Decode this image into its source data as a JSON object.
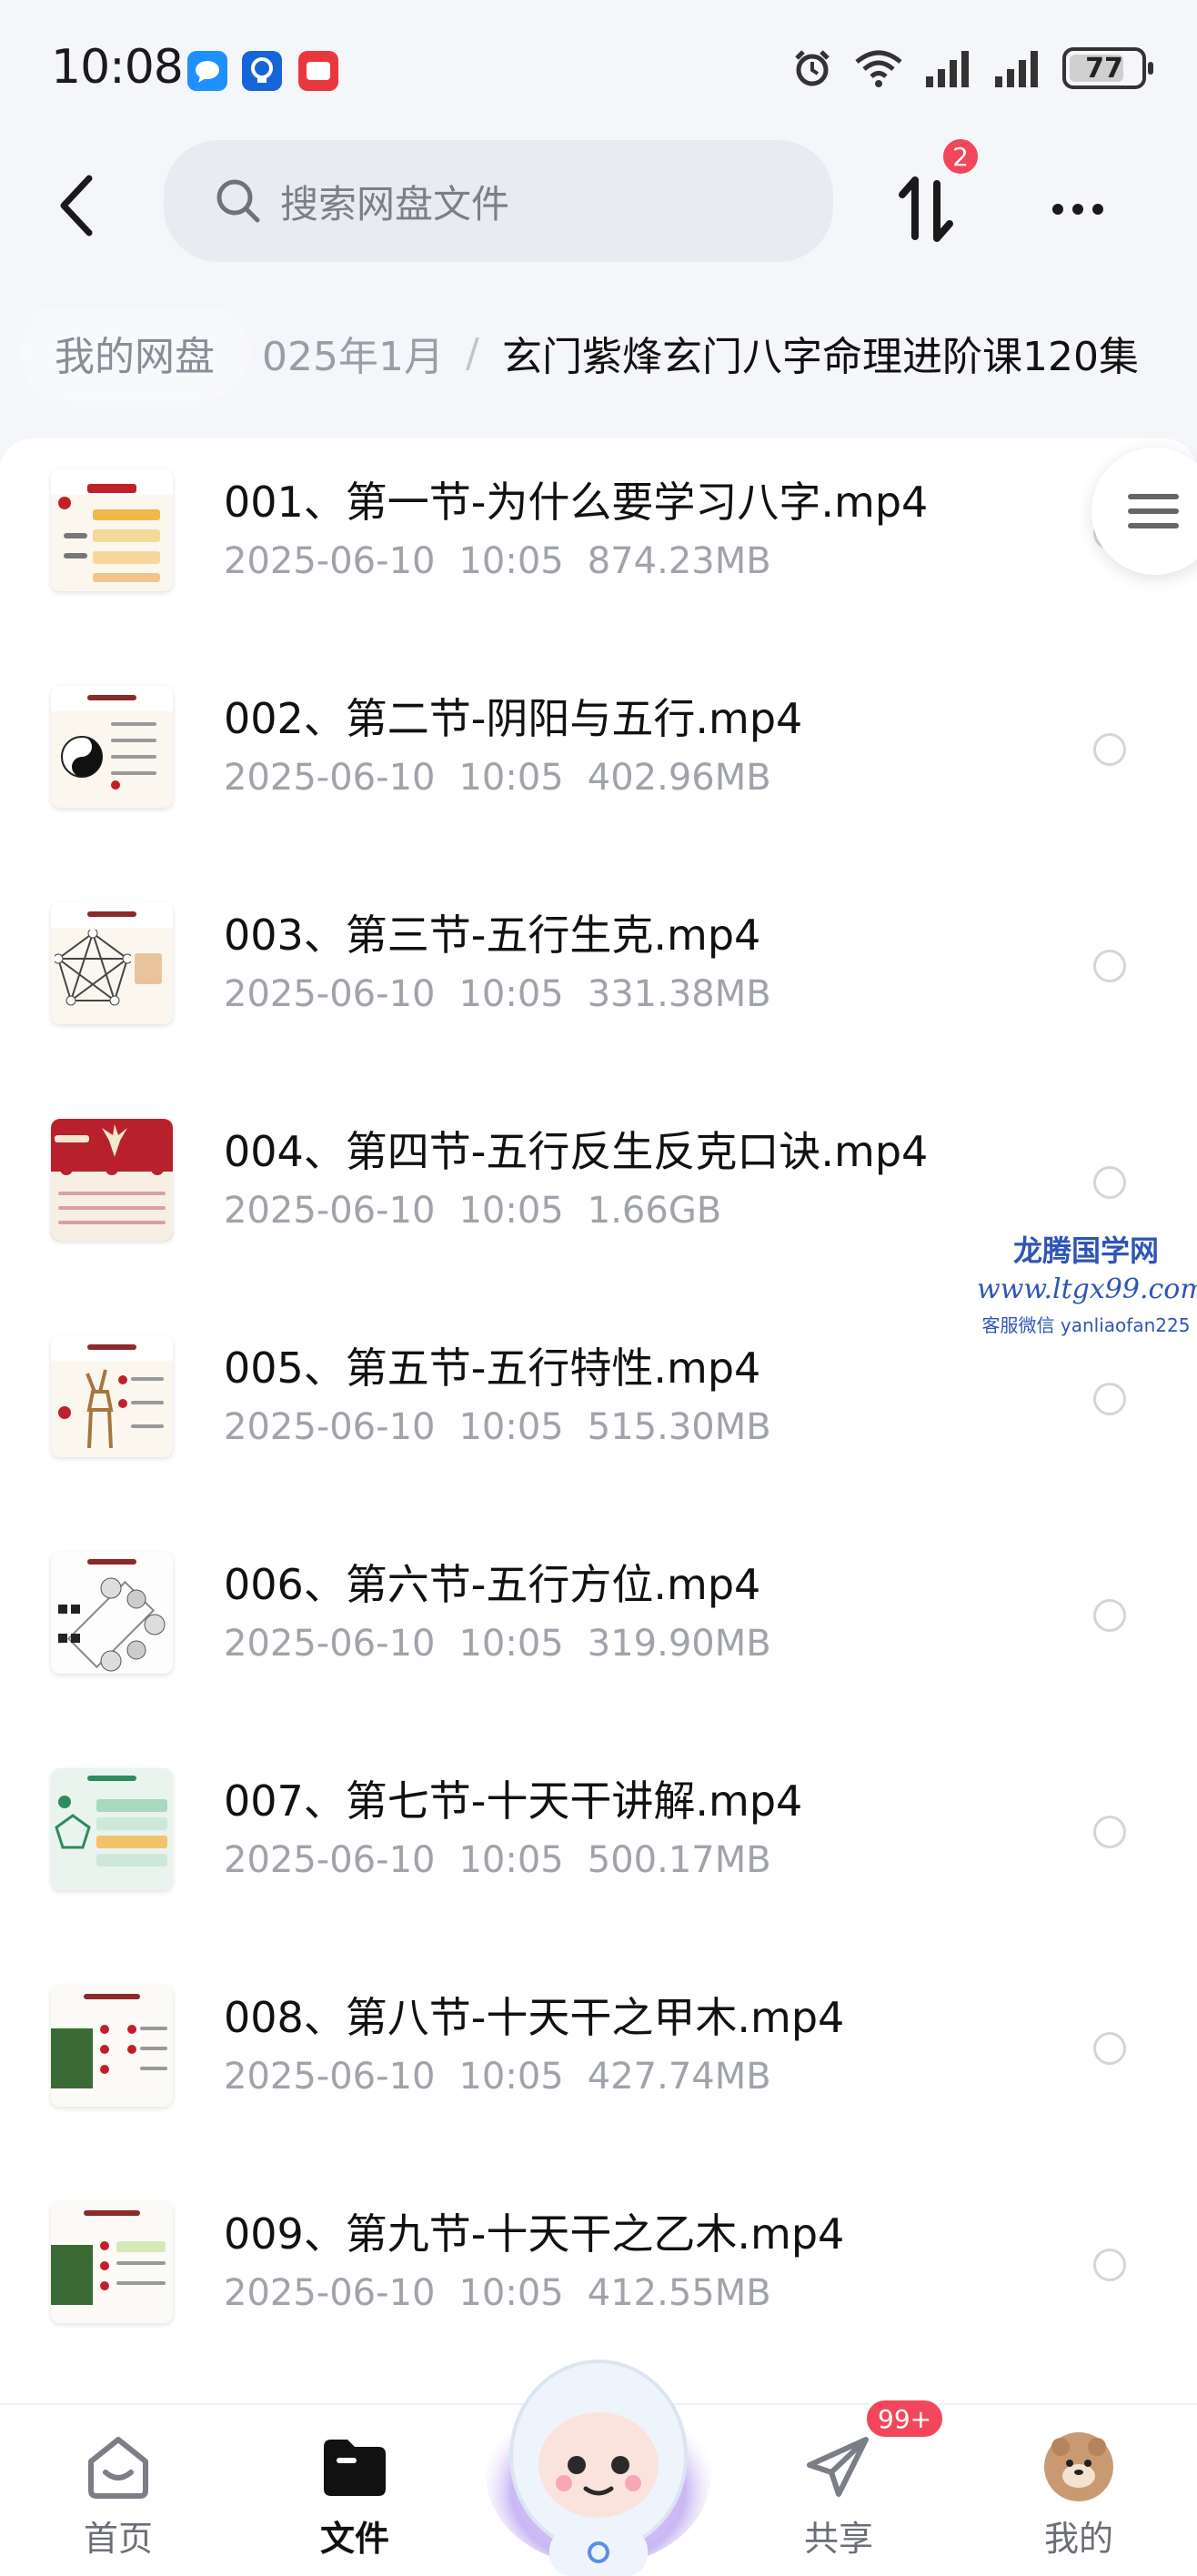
{
  "status_bar": {
    "time": "10:08",
    "battery": "77",
    "battery_level": 0.77,
    "icons": [
      "messages-app-icon",
      "lightbulb-app-icon",
      "video-app-icon",
      "alarm-icon",
      "wifi-icon",
      "signal-icon",
      "signal-icon",
      "battery-icon"
    ]
  },
  "header": {
    "search_placeholder": "搜索网盘文件",
    "transfer_badge": "2"
  },
  "breadcrumb": {
    "root": "我的网盘",
    "middle": "025年1月",
    "separator": "/",
    "current": "玄门紫烽玄门八字命理进阶课120集"
  },
  "files": [
    {
      "name": "001、第一节-为什么要学习八字.mp4",
      "date": "2025-06-10",
      "time": "10:05",
      "size": "874.23MB"
    },
    {
      "name": "002、第二节-阴阳与五行.mp4",
      "date": "2025-06-10",
      "time": "10:05",
      "size": "402.96MB"
    },
    {
      "name": "003、第三节-五行生克.mp4",
      "date": "2025-06-10",
      "time": "10:05",
      "size": "331.38MB"
    },
    {
      "name": "004、第四节-五行反生反克口诀.mp4",
      "date": "2025-06-10",
      "time": "10:05",
      "size": "1.66GB"
    },
    {
      "name": "005、第五节-五行特性.mp4",
      "date": "2025-06-10",
      "time": "10:05",
      "size": "515.30MB"
    },
    {
      "name": "006、第六节-五行方位.mp4",
      "date": "2025-06-10",
      "time": "10:05",
      "size": "319.90MB"
    },
    {
      "name": "007、第七节-十天干讲解.mp4",
      "date": "2025-06-10",
      "time": "10:05",
      "size": "500.17MB"
    },
    {
      "name": "008、第八节-十天干之甲木.mp4",
      "date": "2025-06-10",
      "time": "10:05",
      "size": "427.74MB"
    },
    {
      "name": "009、第九节-十天干之乙木.mp4",
      "date": "2025-06-10",
      "time": "10:05",
      "size": "412.55MB"
    }
  ],
  "watermark": {
    "title": "龙腾国学网",
    "url": "www.ltgx99.com",
    "contact": "客服微信 yanliaofan225"
  },
  "bottom_nav": {
    "home": "首页",
    "files": "文件",
    "share": "共享",
    "share_badge": "99+",
    "me": "我的"
  },
  "colors": {
    "accent_badge": "#f2475a",
    "background": "#f5f6fa",
    "watermark": "#2f55b5"
  }
}
